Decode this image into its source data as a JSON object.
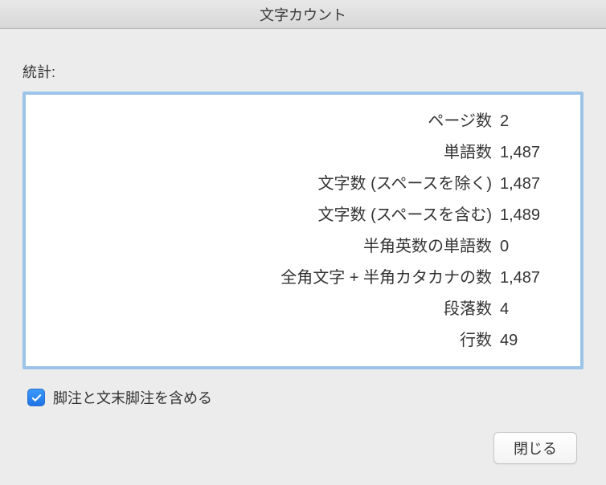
{
  "window": {
    "title": "文字カウント"
  },
  "section_label": "統計:",
  "stats": {
    "pages": {
      "label": "ページ数",
      "value": "2"
    },
    "words": {
      "label": "単語数",
      "value": "1,487"
    },
    "chars_no_spaces": {
      "label": "文字数 (スペースを除く)",
      "value": "1,487"
    },
    "chars_with_spaces": {
      "label": "文字数 (スペースを含む)",
      "value": "1,489"
    },
    "ascii_words": {
      "label": "半角英数の単語数",
      "value": "0"
    },
    "fullwidth_katakana": {
      "label": "全角文字 + 半角カタカナの数",
      "value": "1,487"
    },
    "paragraphs": {
      "label": "段落数",
      "value": "4"
    },
    "lines": {
      "label": "行数",
      "value": "49"
    }
  },
  "checkbox": {
    "label": "脚注と文末脚注を含める",
    "checked": true
  },
  "buttons": {
    "close": "閉じる"
  }
}
